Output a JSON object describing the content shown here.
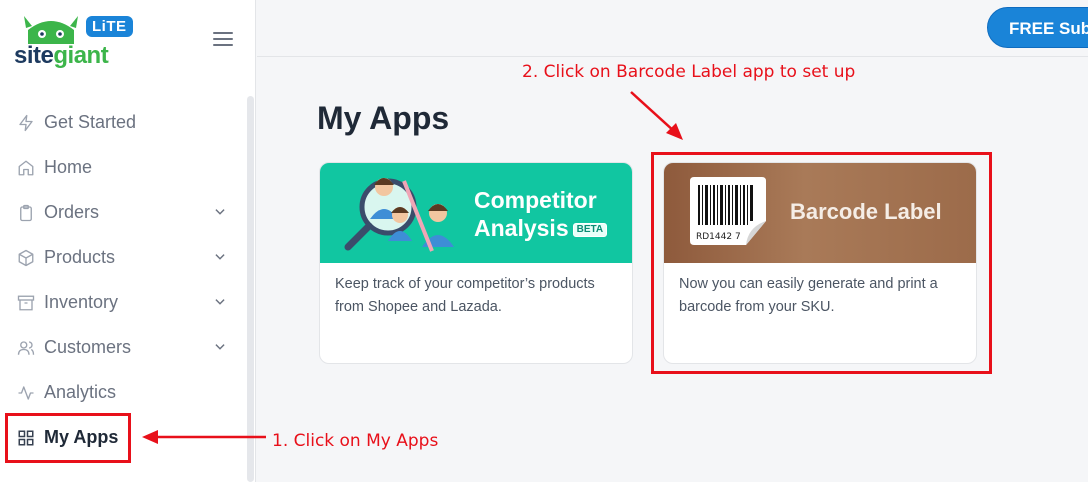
{
  "brand": {
    "lite_badge": "LiTE",
    "name_part1": "site",
    "name_part2": "giant"
  },
  "header": {
    "subscribe_button": "FREE Subscription"
  },
  "sidebar": {
    "items": [
      {
        "label": "Get Started",
        "icon": "bolt-icon"
      },
      {
        "label": "Home",
        "icon": "home-icon"
      },
      {
        "label": "Orders",
        "icon": "clipboard-icon",
        "expandable": true
      },
      {
        "label": "Products",
        "icon": "box-icon",
        "expandable": true
      },
      {
        "label": "Inventory",
        "icon": "archive-icon",
        "expandable": true
      },
      {
        "label": "Customers",
        "icon": "users-icon",
        "expandable": true
      },
      {
        "label": "Analytics",
        "icon": "activity-icon"
      },
      {
        "label": "My Apps",
        "icon": "grid-icon",
        "active": true
      }
    ]
  },
  "main": {
    "title": "My Apps",
    "apps": [
      {
        "banner_title_line1": "Competitor",
        "banner_title_line2": "Analysis",
        "badge": "BETA",
        "description": "Keep track of your competitor’s products from Shopee and Lazada."
      },
      {
        "banner_title": "Barcode Label",
        "barcode_code": "RD1442 7",
        "description": "Now you can easily generate and print a barcode from your SKU."
      }
    ]
  },
  "annotations": {
    "step1": "1. Click on My Apps",
    "step2": "2. Click on Barcode Label app to set up",
    "color": "#e8101a"
  },
  "colors": {
    "primary": "#1a84d8",
    "teal": "#11c6a1",
    "brand_green": "#3cb54a"
  }
}
